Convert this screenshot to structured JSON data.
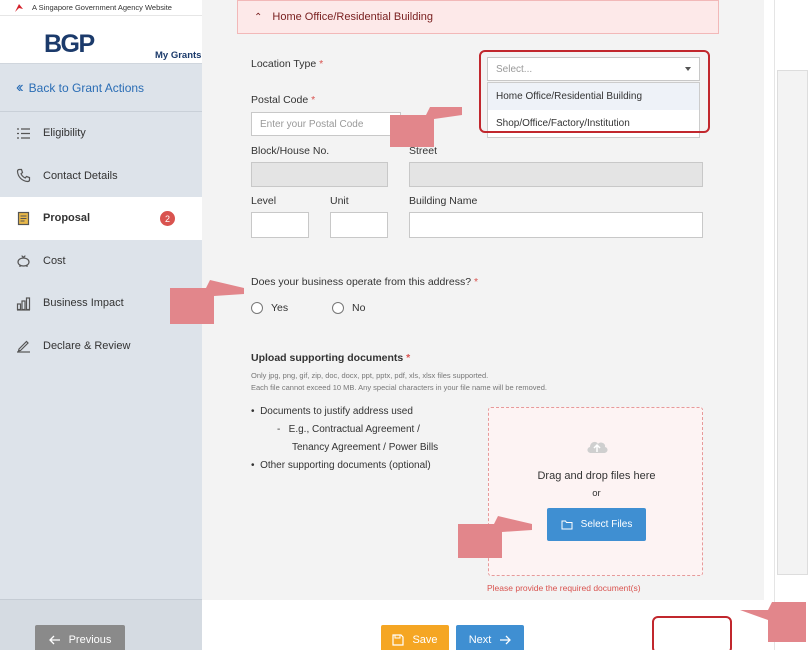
{
  "gov_banner": "A Singapore Government Agency Website",
  "logo": "BGP",
  "my_grants": "My Grants",
  "back_link": "Back to Grant Actions",
  "sidebar": {
    "items": [
      {
        "label": "Eligibility",
        "icon": "list-icon"
      },
      {
        "label": "Contact Details",
        "icon": "phone-icon"
      },
      {
        "label": "Proposal",
        "icon": "document-icon",
        "badge": "2"
      },
      {
        "label": "Cost",
        "icon": "piggy-bank-icon"
      },
      {
        "label": "Business Impact",
        "icon": "bar-chart-icon"
      },
      {
        "label": "Declare & Review",
        "icon": "pen-icon"
      }
    ]
  },
  "section": {
    "title": "Home Office/Residential Building"
  },
  "form": {
    "location_type_label": "Location Type",
    "location_type_placeholder": "Select...",
    "location_options": [
      "Home Office/Residential Building",
      "Shop/Office/Factory/Institution"
    ],
    "postal_code_label": "Postal Code",
    "postal_code_placeholder": "Enter your Postal Code",
    "block_label": "Block/House No.",
    "street_label": "Street",
    "level_label": "Level",
    "unit_label": "Unit",
    "building_label": "Building Name",
    "operate_question": "Does your business operate from this address?",
    "yes": "Yes",
    "no": "No",
    "upload_label": "Upload supporting documents",
    "upload_hint_1": "Only jpg, png, gif, zip, doc, docx, ppt, pptx, pdf, xls, xlsx files supported.",
    "upload_hint_2": "Each file cannot exceed 10 MB. Any special characters in your file name will be removed.",
    "bullet_1": "Documents to justify address used",
    "bullet_1_sub_1": "E.g., Contractual Agreement /",
    "bullet_1_sub_2": "Tenancy Agreement / Power Bills",
    "bullet_2": "Other supporting documents (optional)",
    "drop_text": "Drag and drop files here",
    "or_text": "or",
    "select_files": "Select Files",
    "error": "Please provide the required document(s)"
  },
  "buttons": {
    "previous": "Previous",
    "save": "Save",
    "next": "Next"
  },
  "colors": {
    "accent": "#3f8fd2",
    "highlight": "#c1272d",
    "save": "#f5a623",
    "hand": "#e2868b"
  }
}
